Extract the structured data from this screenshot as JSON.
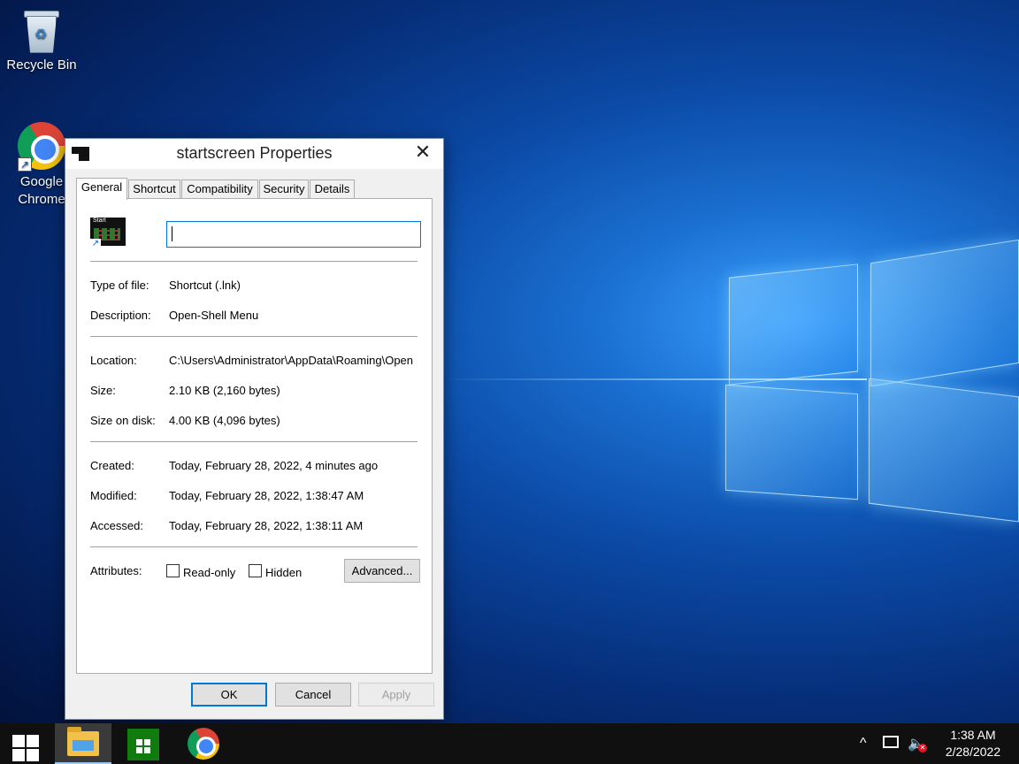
{
  "desktop": {
    "icons": [
      {
        "label": "Recycle Bin",
        "icon": "recycle-bin-icon"
      },
      {
        "label": "Google Chrome",
        "icon": "chrome-icon"
      }
    ]
  },
  "dialog": {
    "title": "startscreen Properties",
    "close_glyph": "✕",
    "tabs": [
      {
        "label": "General",
        "active": true
      },
      {
        "label": "Shortcut"
      },
      {
        "label": "Compatibility"
      },
      {
        "label": "Security"
      },
      {
        "label": "Details"
      }
    ],
    "icon_text": "Start",
    "file_name": "",
    "props": {
      "type_label": "Type of file:",
      "type_value": "Shortcut (.lnk)",
      "desc_label": "Description:",
      "desc_value": "Open-Shell Menu",
      "location_label": "Location:",
      "location_value": "C:\\Users\\Administrator\\AppData\\Roaming\\Open",
      "size_label": "Size:",
      "size_value": "2.10 KB (2,160 bytes)",
      "disk_label": "Size on disk:",
      "disk_value": "4.00 KB (4,096 bytes)",
      "created_label": "Created:",
      "created_value": "Today, February 28, 2022, 4 minutes ago",
      "modified_label": "Modified:",
      "modified_value": "Today, February 28, 2022, 1:38:47 AM",
      "accessed_label": "Accessed:",
      "accessed_value": "Today, February 28, 2022, 1:38:11 AM"
    },
    "attributes": {
      "label": "Attributes:",
      "readonly": "Read-only",
      "hidden": "Hidden",
      "advanced": "Advanced..."
    },
    "buttons": {
      "ok": "OK",
      "cancel": "Cancel",
      "apply": "Apply"
    }
  },
  "taskbar": {
    "tray_chevron": "^",
    "time": "1:38 AM",
    "date": "2/28/2022"
  }
}
